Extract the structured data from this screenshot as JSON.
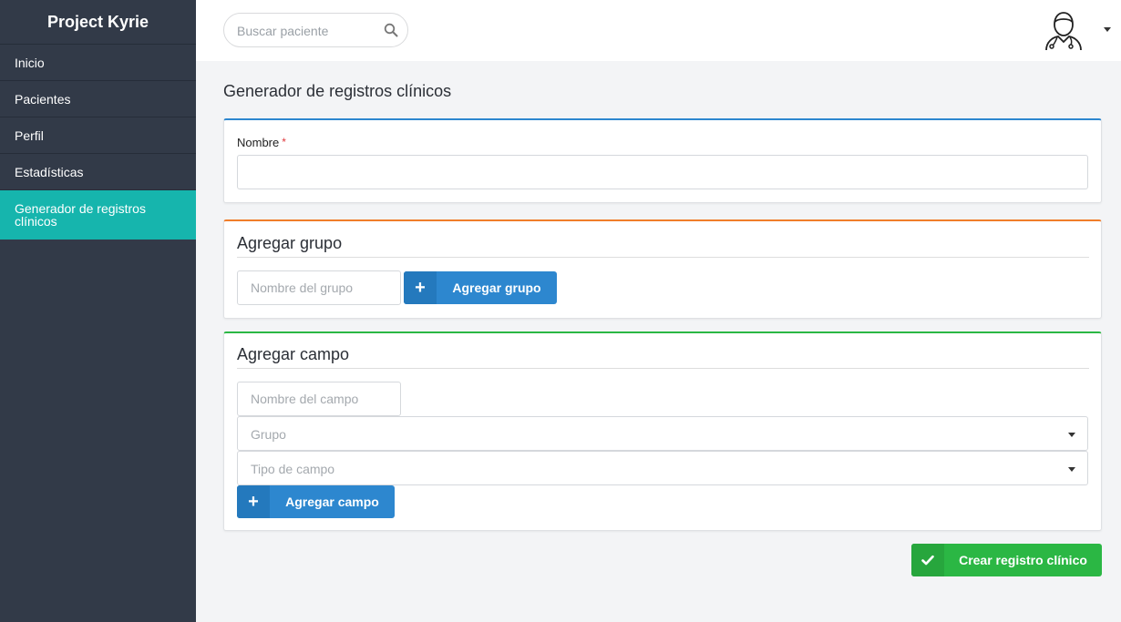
{
  "sidebar": {
    "brand": "Project Kyrie",
    "items": [
      {
        "label": "Inicio"
      },
      {
        "label": "Pacientes"
      },
      {
        "label": "Perfil"
      },
      {
        "label": "Estadísticas"
      },
      {
        "label": "Generador de registros clínicos",
        "active": true
      }
    ]
  },
  "topbar": {
    "search_placeholder": "Buscar paciente",
    "search_icon": "search-icon",
    "avatar_icon": "doctor-avatar-icon"
  },
  "main": {
    "title": "Generador de registros clínicos",
    "name_card": {
      "label": "Nombre",
      "required_mark": "*",
      "value": ""
    },
    "group_card": {
      "title": "Agregar grupo",
      "input_placeholder": "Nombre del grupo",
      "button_label": "Agregar grupo",
      "button_icon": "+"
    },
    "field_card": {
      "title": "Agregar campo",
      "input_placeholder": "Nombre del campo",
      "group_select": "Grupo",
      "type_select": "Tipo de campo",
      "button_label": "Agregar campo",
      "button_icon": "+"
    },
    "submit": {
      "label": "Crear registro clínico",
      "icon": "check-icon"
    }
  },
  "colors": {
    "sidebar_bg": "#323a48",
    "active_item": "#16b5ad",
    "primary_blue": "#2d87cf",
    "accent_orange": "#f07d2a",
    "success_green": "#2bb744"
  }
}
